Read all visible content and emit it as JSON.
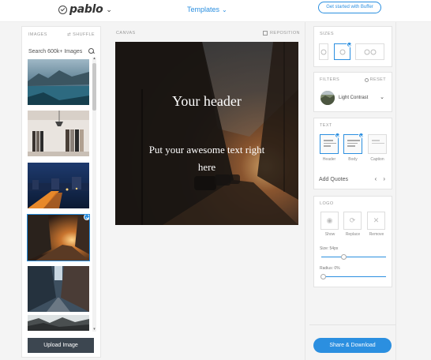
{
  "topbar": {
    "brand": "pablo",
    "templates_label": "Templates",
    "cta_label": "Get started with Buffer"
  },
  "images_panel": {
    "title": "IMAGES",
    "shuffle_label": "SHUFFLE",
    "search_placeholder": "Search 600k+ Images",
    "upload_label": "Upload Image",
    "thumbnails": [
      "lake-mountains",
      "clothing-rack",
      "city-night",
      "sunset-street",
      "narrow-alley",
      "misty-landscape"
    ],
    "selected_index": 3
  },
  "canvas": {
    "label": "CANVAS",
    "reposition_label": "REPOSITION",
    "header_text": "Your header",
    "body_text": "Put your awesome text right here"
  },
  "sizes": {
    "title": "SIZES",
    "selected_index": 1
  },
  "filters": {
    "title": "FILTERS",
    "reset_label": "RESET",
    "selected_filter": "Light Contrast"
  },
  "text": {
    "title": "TEXT",
    "options": [
      {
        "label": "Header",
        "checked": true
      },
      {
        "label": "Body",
        "checked": true
      },
      {
        "label": "Caption",
        "checked": false
      }
    ],
    "add_quotes_label": "Add Quotes"
  },
  "logo": {
    "title": "LOGO",
    "actions": [
      {
        "label": "Show",
        "icon": "eye-icon"
      },
      {
        "label": "Replace",
        "icon": "refresh-icon"
      },
      {
        "label": "Remove",
        "icon": "close-icon"
      }
    ],
    "size_label": "Size: 54px",
    "size_value": 0.35,
    "radius_label": "Radius: 0%",
    "radius_value": 0
  },
  "share_label": "Share & Download",
  "colors": {
    "accent": "#2b8fe0",
    "upload_button": "#3c4650",
    "panel_bg": "#f4f4f4"
  }
}
